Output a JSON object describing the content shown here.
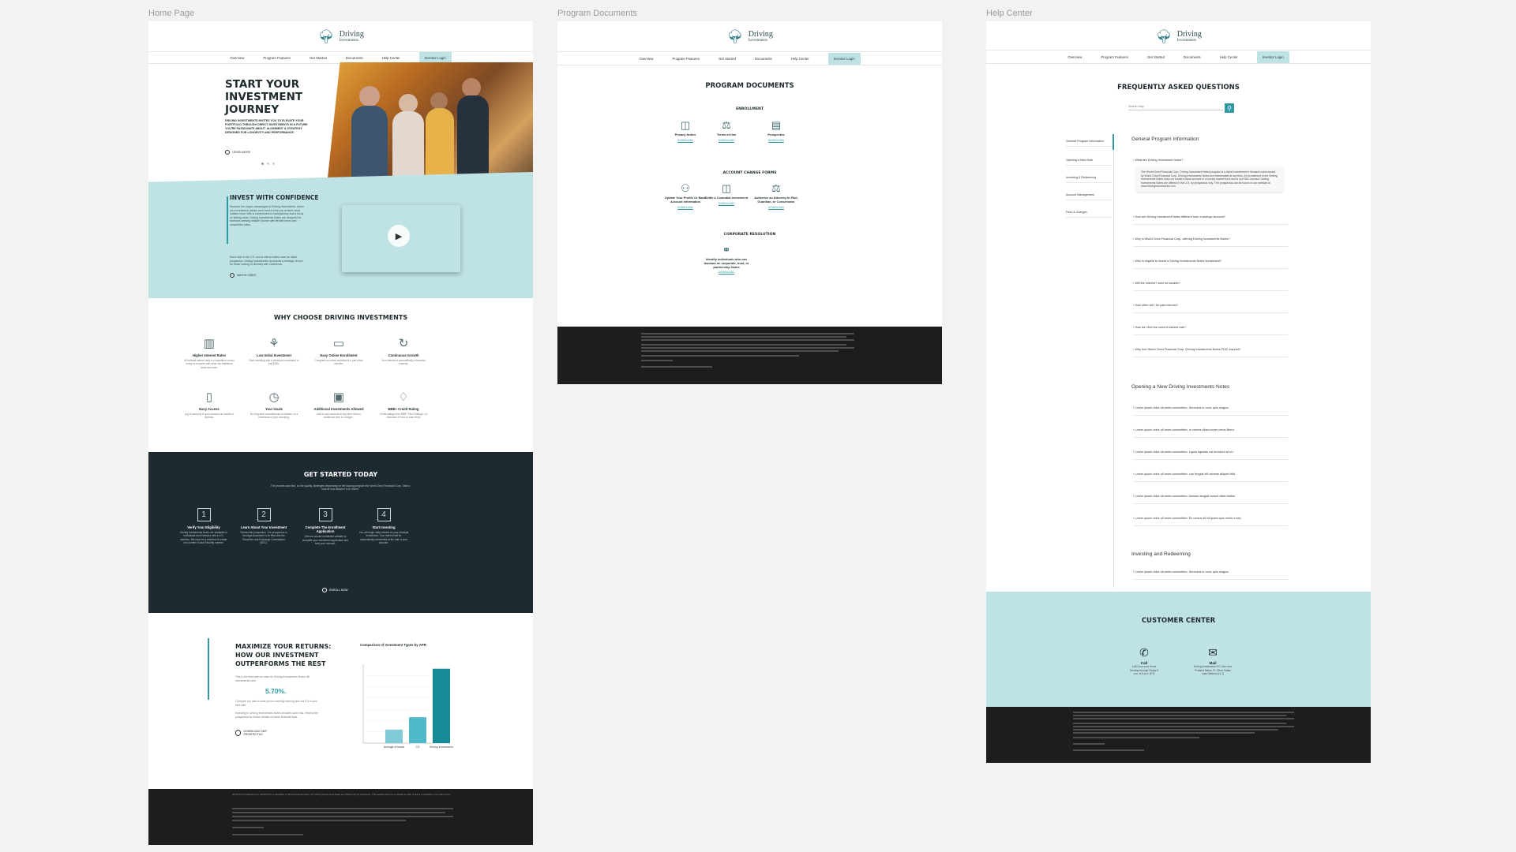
{
  "canvas_labels": {
    "home": "Home Page",
    "docs": "Program Documents",
    "help": "Help Center"
  },
  "brand": {
    "name": "Driving",
    "sub": "Investments",
    "accent": "#bfe2e5",
    "teal": "#2f9aa4",
    "dark": "#1d2a30"
  },
  "nav": {
    "overview": "Overview",
    "features": "Program Features",
    "started": "Get Started",
    "documents": "Documents",
    "help": "Help Center",
    "login": "Investor Login"
  },
  "home": {
    "hero_title": "START YOUR INVESTMENT JOURNEY",
    "hero_text": "DRIVING INVESTMENTS INVITES YOU TO ELEVATE YOUR PORTFOLIO THROUGH DIRECT INVESTMENTS IN A FUTURE YOU'RE PASSIONATE ABOUT. ALIGNMENT & STRATEGY DESIGNED FOR LONGEVITY AND PERFORMANCE.",
    "hero_btn": "LEARN MORE",
    "confidence_title": "INVEST WITH CONFIDENCE",
    "confidence_text": "Discover the unique advantages of Driving Investments, where your investment dollars work hard to help you achieve what matters most. With a commitment to transparency and a focus on lasting value, Driving Investments Notes are designed for investors seeking reliable income with flexible terms and competitive rates.",
    "confidence_text2": "Each note in the U.S. and is offered within each an initial prospectus. Driving Investments represents a strategic choice for those looking to diversify with confidence.",
    "watch_btn": "WATCH VIDEO",
    "why_title": "WHY CHOOSE DRIVING INVESTMENTS",
    "features": [
      {
        "icon": "chart-icon",
        "glyph": "▥",
        "title": "Higher Interest Rates",
        "desc": "All interest earned daily is competitive versus today to compete with other top traditional bank accounts."
      },
      {
        "icon": "plant-icon",
        "glyph": "⚘",
        "title": "Low Initial Investment",
        "desc": "Start investing with a minimum investment of just $250."
      },
      {
        "icon": "laptop-icon",
        "glyph": "▭",
        "title": "Easy Online Enrollment",
        "desc": "Complete an online enrollment in just a few minutes."
      },
      {
        "icon": "growth-icon",
        "glyph": "↻",
        "title": "Continuous Growth",
        "desc": "Your interest is automatically reinvested monthly."
      },
      {
        "icon": "phone-icon",
        "glyph": "▯",
        "title": "Easy Access",
        "desc": "Log in securely to your account on mobile or desktop."
      },
      {
        "icon": "timer-icon",
        "glyph": "◷",
        "title": "Your Goals",
        "desc": "No long-term commitments to redeem on a timeframe of your choosing."
      },
      {
        "icon": "cash-icon",
        "glyph": "▣",
        "title": "Additional Investments Allowed",
        "desc": "Add to your account at any time with no additional fees or charges."
      },
      {
        "icon": "thumb-icon",
        "glyph": "♢",
        "title": "BBB+ Credit Rating",
        "desc": "Credit ratings from BBB+ Fitch Ratings, Ca Standard & Poor's Learn More"
      }
    ],
    "steps_title": "GET STARTED TODAY",
    "steps_intro": "The process was fast, so the quality, strategies depending on the issuing program the World Omni Financial Corp. Take a look at how simple it is to invest.",
    "steps": [
      {
        "num": "1",
        "title": "Verify Your Eligibility",
        "desc": "Driving Investments Notes are available to individuals and investors with a U.S. address. We must be a resident of a state and confirm Social Security number."
      },
      {
        "num": "2",
        "title": "Learn About Your Investment",
        "desc": "Review the prospectus. The prospectus is the legal document to be filed with the Securities and Exchange Commission (SEC)."
      },
      {
        "num": "3",
        "title": "Complete The Enrollment Application",
        "desc": "Visit our secure enrollment website to complete your enrollment application and fund your account."
      },
      {
        "num": "4",
        "title": "Start Investing",
        "desc": "You will begin daily interest on your principal investment. Your interest will be automatically reinvested at the rate of your account."
      }
    ],
    "enroll_btn": "ENROLL NOW",
    "returns_title": "MAXIMIZE YOUR RETURNS: HOW OUR INVESTMENT OUTPERFORMS THE REST",
    "returns_text": "This is the best rate we have for Driving Investments Notes: All investments earn",
    "returns_rate": "5.70%.",
    "returns_text2": "Compare our rate to what you're currently earning and see if it is your best rate.",
    "returns_text3": "Investing in Driving Investments Notes involves some risk. Review the prospectus for further details on these financial risks.",
    "prospectus_btn": "DOWNLOAD OUR PROSPECTUS",
    "footer_text": "World Omni Financial Corp. (WOFCO) is a subsidiary of JM Family Enterprises, Inc. Driving Investments Notes are offered only by prospectus. This website does not constitute an offer to sell or a solicitation of an offer to buy."
  },
  "chart_data": {
    "type": "bar",
    "title": "Comparison of Investment Types by APR",
    "categories": [
      "Average of banks",
      "CD",
      "Driving Investments"
    ],
    "values": [
      1.2,
      2.3,
      6.6
    ],
    "ylim": [
      0,
      7
    ]
  },
  "docs": {
    "title": "PROGRAM DOCUMENTS",
    "enrollment_title": "ENROLLMENT",
    "enrollment": [
      {
        "icon": "privacy-doc-icon",
        "glyph": "◫",
        "title": "Privacy Notice",
        "link": "DOWNLOAD"
      },
      {
        "icon": "terms-doc-icon",
        "glyph": "⚖",
        "title": "Terms of Use",
        "link": "DOWNLOAD"
      },
      {
        "icon": "prospectus-doc-icon",
        "glyph": "▤",
        "title": "Prospectus",
        "link": "DOWNLOAD"
      }
    ],
    "change_title": "ACCOUNT CHANGE FORMS",
    "change": [
      {
        "icon": "profile-form-icon",
        "glyph": "⚇",
        "title": "Update Your Profile Or Bank Account Information",
        "link": "DOWNLOAD"
      },
      {
        "icon": "custodial-form-icon",
        "glyph": "◫",
        "title": "Settle a Custodial Investment",
        "link": "DOWNLOAD"
      },
      {
        "icon": "authorize-form-icon",
        "glyph": "⚖",
        "title": "Authorize an Attorney-In-Fact, Guardian, or Conservator",
        "link": "DOWNLOAD"
      }
    ],
    "corporate_title": "CORPORATE RESOLUTION",
    "corporate": [
      {
        "icon": "handshake-icon",
        "glyph": "⚭",
        "title": "Identify individuals who can transact on corporate, trust, or partnership Notes",
        "link": "DOWNLOAD"
      }
    ]
  },
  "help": {
    "title": "FREQUENTLY ASKED QUESTIONS",
    "search_placeholder": "Search Help",
    "sidebar": [
      "General Program Information",
      "Opening a New Note",
      "Investing & Redeeming",
      "Account Management",
      "Fees & Charges"
    ],
    "cat1": "General Program Information",
    "q_open": "What are Driving Investment Notes?",
    "a_open": "The World Omni Financial Corp. Driving Investment Notes program is a direct investment in demand notes issued by World Omni Financial Corp. Driving Investments Notes are redeemable at any time. An investment in the Driving Investments Notes does not create a bank account or a money market fund and is not FDIC insured. Driving Investments Notes are offered in the U.S. by prospectus only. The prospectus can be found on our website at www.drivinginvestments.com.",
    "questions1": [
      "How are Driving Investment Notes different from a savings account?",
      "Why is World Omni Financial Corp. offering Driving Investments Notes?",
      "Who is eligible to invest a Driving Investments Notes investment?",
      "Will the interest I earn be taxable?",
      "How often will I be paid interest?",
      "How do I find the current interest rate?",
      "Why isn't World Omni Financial Corp. Driving Investments Notes FDIC insured?"
    ],
    "cat2": "Opening a New Driving Investments Notes",
    "questions2": [
      "Lorem ipsum dolor sit amet consectetur. Senectus in nunc quis magna.",
      "Lorem ipsum dolor sit amet consectetur. In viverra ullamcorper netus libero.",
      "Lorem ipsum dolor sit amet consectetur. Ligula egestas est tincidunt sit eu.",
      "Lorem ipsum dolor sit amet consectetur. Leo feugiat elit aenean aliquet felis.",
      "Lorem ipsum dolor sit amet consectetur. Aenean feugiat cursus vitae facilisi.",
      "Lorem ipsum dolor sit amet consectetur. Ex cursus sit sit quam quis morbi a sed."
    ],
    "cat3": "Investing and Redeeming",
    "questions3": [
      "Lorem ipsum dolor sit amet consectetur. Senectus in nunc quis magna."
    ],
    "customer_title": "CUSTOMER CENTER",
    "call_label": "Call",
    "call_text": "1-800-xxx-xxxx Hours Monday through Friday 8 a.m. to 5 p.m. (ET)",
    "mail_label": "Mail",
    "mail_text": "Driving Investments P.O. Box xxxx Portland Maine, FL 33xxx Dallas Lake Wishton (LLJ)"
  }
}
